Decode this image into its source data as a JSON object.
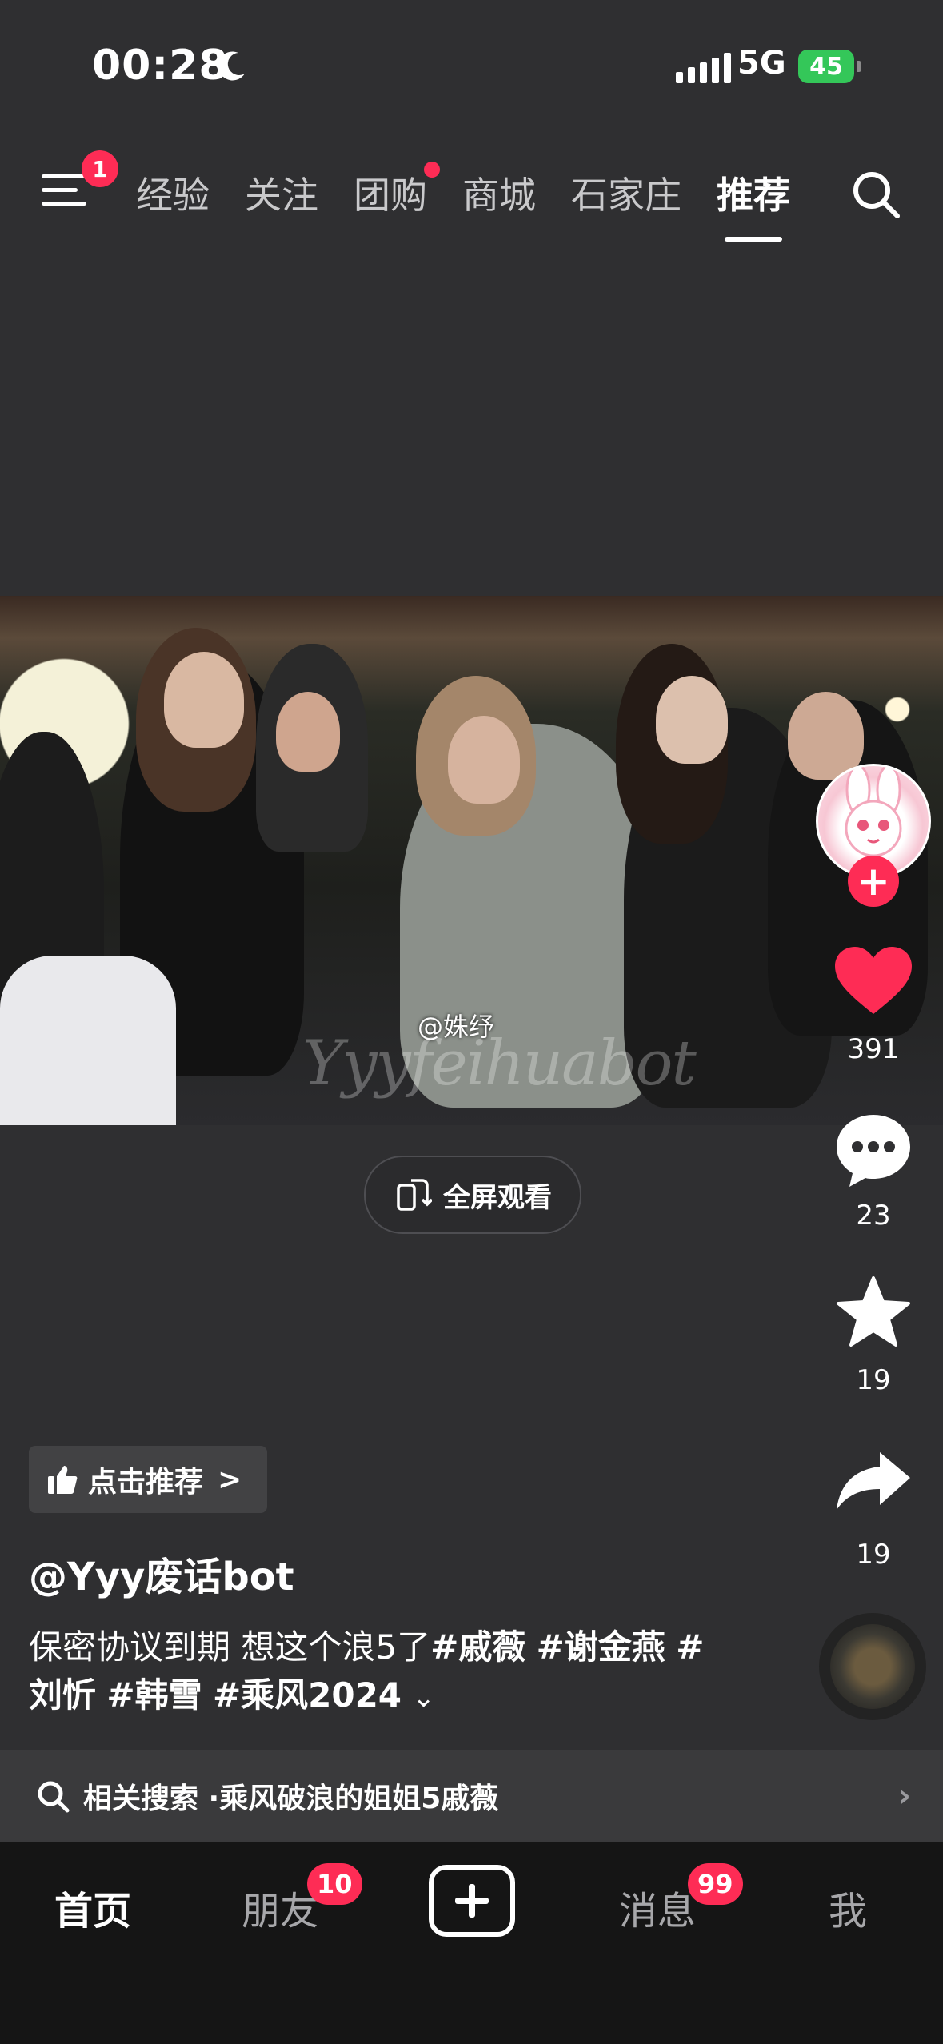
{
  "status": {
    "time": "00:28",
    "network": "5G",
    "battery": "45"
  },
  "top_nav": {
    "menu_badge": "1",
    "tabs": [
      {
        "label": "经验"
      },
      {
        "label": "关注"
      },
      {
        "label": "团购"
      },
      {
        "label": "商城"
      },
      {
        "label": "石家庄"
      },
      {
        "label": "推荐"
      }
    ],
    "active_tab": "推荐"
  },
  "video": {
    "watermark": "@姝纾",
    "script_watermark": "Yyyfeihuabot"
  },
  "fullscreen_label": "全屏观看",
  "rail": {
    "likes": "391",
    "comments": "23",
    "favorites": "19",
    "shares": "19"
  },
  "recommend_label": "点击推荐",
  "author": "@Yyy废话bot",
  "description": {
    "text": "保密协议到期 想这个浪5了",
    "tags": [
      "#戚薇",
      "#谢金燕",
      "#",
      "刘忻",
      "#韩雪",
      "#乘风2024"
    ]
  },
  "related": {
    "prefix": "相关搜索 · ",
    "query": "乘风破浪的姐姐5戚薇"
  },
  "bottom_nav": {
    "home": "首页",
    "friends": "朋友",
    "friends_badge": "10",
    "messages": "消息",
    "messages_badge": "99",
    "me": "我"
  },
  "colors": {
    "accent": "#fe2c55",
    "background": "#2f2f31",
    "battery": "#34c759"
  }
}
